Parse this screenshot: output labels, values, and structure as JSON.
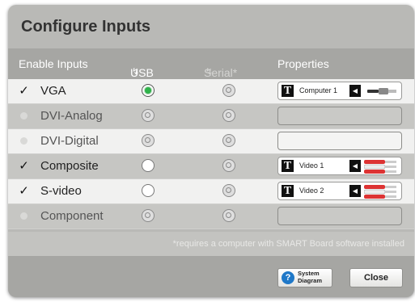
{
  "dialog": {
    "title": "Configure Inputs",
    "header": {
      "enable": "Enable Inputs",
      "usb": "USB",
      "serial": "Serial*",
      "properties": "Properties"
    },
    "rows": [
      {
        "name": "VGA",
        "enabled": true,
        "usb": "selected",
        "serial": "disabled",
        "property": {
          "label": "Computer 1",
          "cable": "vga"
        }
      },
      {
        "name": "DVI-Analog",
        "enabled": false,
        "usb": "disabled",
        "serial": "disabled",
        "property": null
      },
      {
        "name": "DVI-Digital",
        "enabled": false,
        "usb": "disabled",
        "serial": "disabled",
        "property": null
      },
      {
        "name": "Composite",
        "enabled": true,
        "usb": "empty",
        "serial": "disabled",
        "property": {
          "label": "Video 1",
          "cable": "rca"
        }
      },
      {
        "name": "S-video",
        "enabled": true,
        "usb": "empty",
        "serial": "disabled",
        "property": {
          "label": "Video 2",
          "cable": "rca"
        }
      },
      {
        "name": "Component",
        "enabled": false,
        "usb": "disabled",
        "serial": "disabled",
        "property": null
      }
    ],
    "note": "*requires a computer with SMART Board software installed",
    "buttons": {
      "system_line1": "System",
      "system_line2": "Diagram",
      "close": "Close"
    }
  },
  "icons": {
    "check": "checkmark-icon",
    "usb_plug": "usb-plug-icon",
    "serial_plug": "serial-plug-icon",
    "text": "text-T-icon",
    "speaker": "speaker-icon",
    "help": "help-question-icon"
  },
  "colors": {
    "selected_radio": "#2fb24a",
    "help_icon": "#1f78c8",
    "dialog_bg": "#b9b9b6"
  }
}
